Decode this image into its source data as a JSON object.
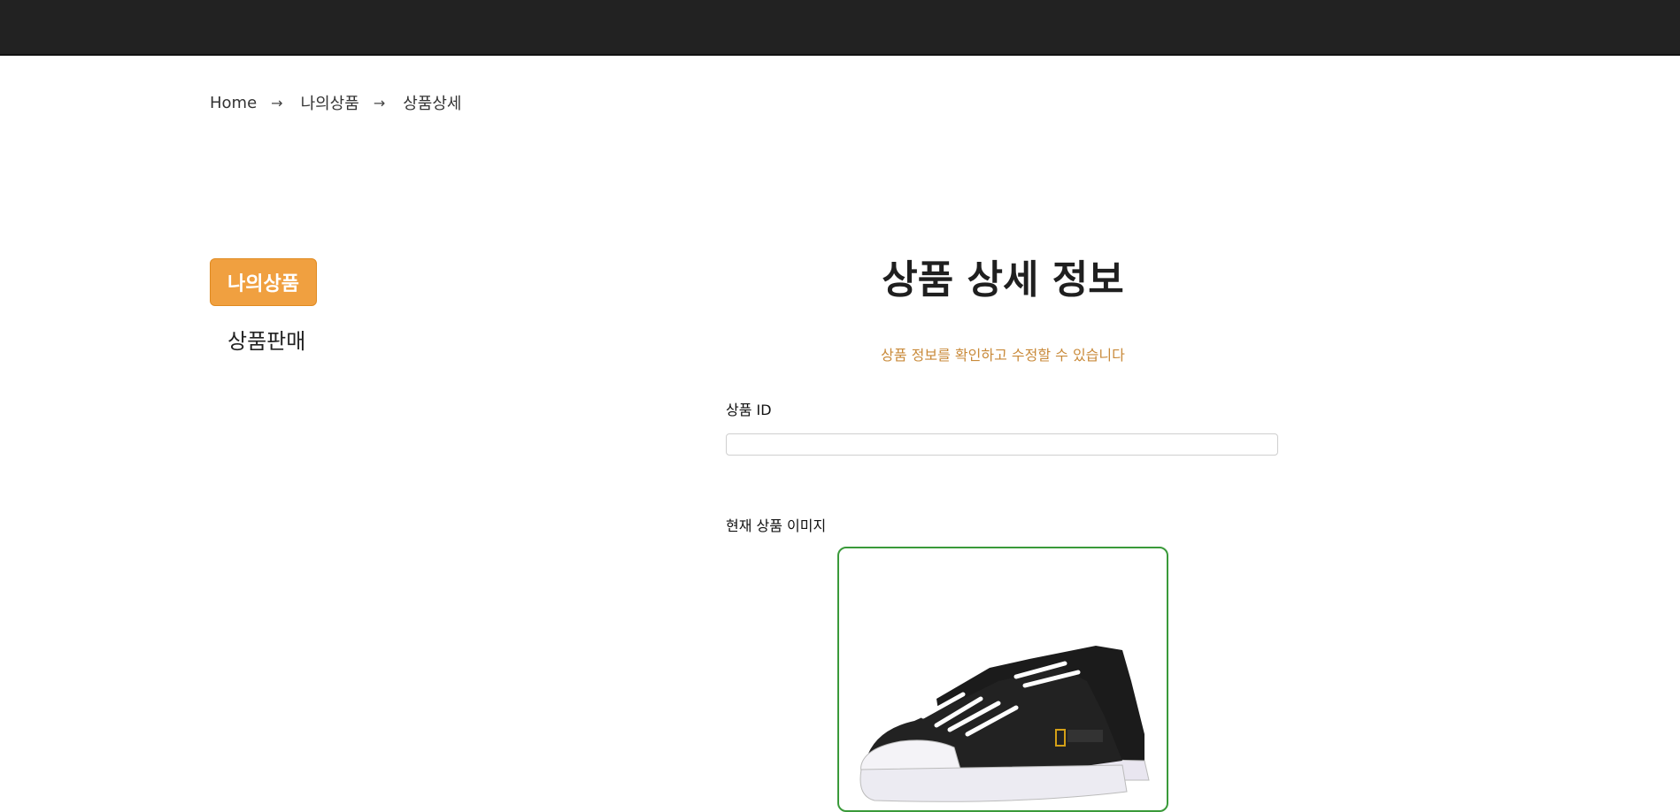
{
  "breadcrumb": {
    "items": [
      "Home",
      "나의상품",
      "상품상세"
    ],
    "separator": "→"
  },
  "sidebar": {
    "active_item": "나의상품",
    "items": [
      "상품판매"
    ]
  },
  "main": {
    "title": "상품 상세 정보",
    "subtitle": "상품 정보를 확인하고 수정할 수 있습니다",
    "product_id_label": "상품 ID",
    "product_id_value": "",
    "current_image_label": "현재 상품 이미지"
  },
  "colors": {
    "topbar": "#222222",
    "accent": "#f0a040",
    "subtitle": "#c98a3a",
    "image_border": "#3a9a3a"
  }
}
